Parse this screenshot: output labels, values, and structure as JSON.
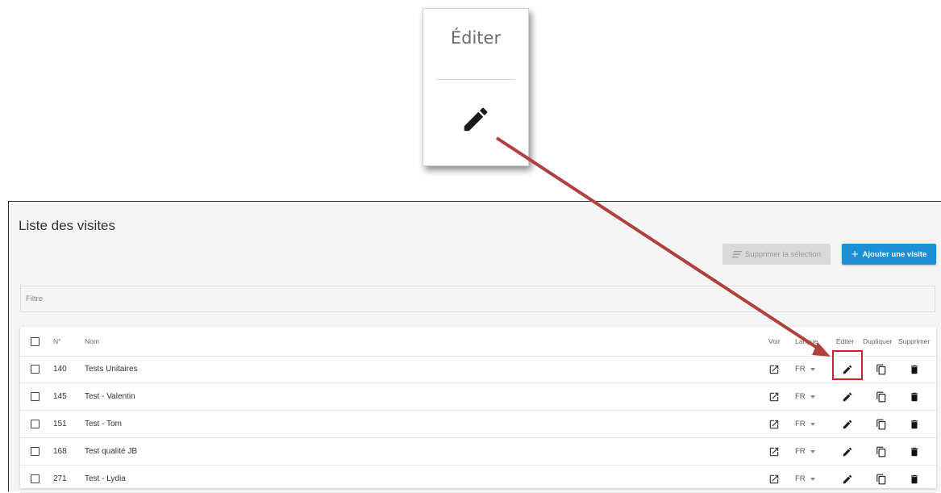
{
  "callout": {
    "title": "Éditer"
  },
  "page": {
    "title": "Liste des visites",
    "delete_selection_label": "Supprimer la sélection",
    "add_visit_label": "Ajouter une visite",
    "filter_placeholder": "Filtre"
  },
  "table": {
    "headers": {
      "number": "N°",
      "name": "Nom",
      "view": "Voir",
      "language": "Langue",
      "edit": "Éditer",
      "duplicate": "Dupliquer",
      "delete": "Supprimer"
    },
    "rows": [
      {
        "number": "140",
        "name": "Tests Unitaires",
        "language": "FR"
      },
      {
        "number": "145",
        "name": "Test - Valentin",
        "language": "FR"
      },
      {
        "number": "151",
        "name": "Test - Tom",
        "language": "FR"
      },
      {
        "number": "168",
        "name": "Test qualité JB",
        "language": "FR"
      },
      {
        "number": "271",
        "name": "Test - Lydia",
        "language": "FR"
      }
    ]
  },
  "colors": {
    "primary": "#1c8fd6",
    "highlight_box": "#d0202e",
    "arrow": "#b0413e"
  },
  "icons": {
    "view": "open-in-new-icon",
    "edit": "pencil-icon",
    "duplicate": "copy-icon",
    "delete": "trash-icon"
  }
}
